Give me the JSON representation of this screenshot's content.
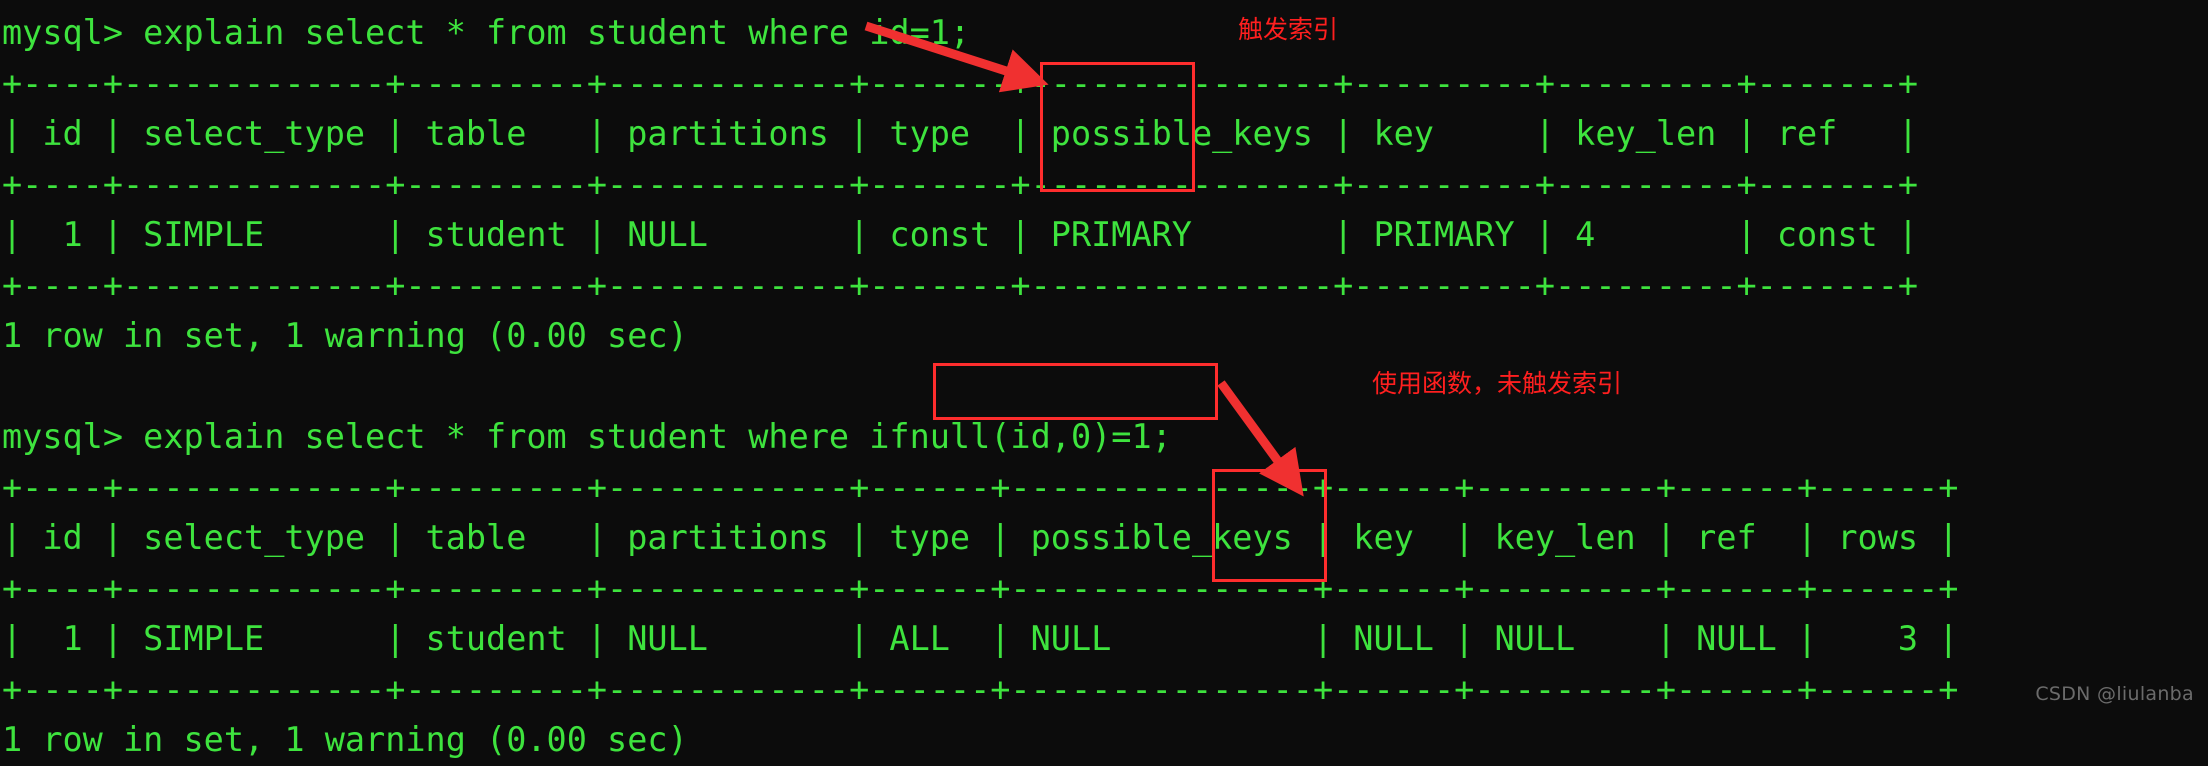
{
  "terminal": {
    "background_color": "#0c0c0c",
    "text_color": "#3ee33e",
    "annotation_color": "#ff2d2d",
    "lines": [
      "mysql> explain select * from student where id=1;",
      "+----+-------------+---------+------------+-------+---------------+---------+---------+-------+",
      "| id | select_type | table   | partitions | type  | possible_keys | key     | key_len | ref   |",
      "+----+-------------+---------+------------+-------+---------------+---------+---------+-------+",
      "|  1 | SIMPLE      | student | NULL       | const | PRIMARY       | PRIMARY | 4       | const |",
      "+----+-------------+---------+------------+-------+---------------+---------+---------+-------+",
      "1 row in set, 1 warning (0.00 sec)",
      "",
      "mysql> explain select * from student where ifnull(id,0)=1;",
      "+----+-------------+---------+------------+------+---------------+------+---------+------+------+",
      "| id | select_type | table   | partitions | type | possible_keys | key  | key_len | ref  | rows |",
      "+----+-------------+---------+------------+------+---------------+------+---------+------+------+",
      "|  1 | SIMPLE      | student | NULL       | ALL  | NULL          | NULL | NULL    | NULL |    3 |",
      "+----+-------------+---------+------------+------+---------------+------+---------+------+------+",
      "1 row in set, 1 warning (0.00 sec)"
    ]
  },
  "queries": [
    {
      "prompt": "mysql>",
      "sql": "explain select * from student where id=1;",
      "result_status": "1 row in set, 1 warning (0.00 sec)",
      "columns": [
        "id",
        "select_type",
        "table",
        "partitions",
        "type",
        "possible_keys",
        "key",
        "key_len",
        "ref"
      ],
      "rows": [
        [
          "1",
          "SIMPLE",
          "student",
          "NULL",
          "const",
          "PRIMARY",
          "PRIMARY",
          "4",
          "const"
        ]
      ]
    },
    {
      "prompt": "mysql>",
      "sql": "explain select * from student where ifnull(id,0)=1;",
      "result_status": "1 row in set, 1 warning (0.00 sec)",
      "columns": [
        "id",
        "select_type",
        "table",
        "partitions",
        "type",
        "possible_keys",
        "key",
        "key_len",
        "ref",
        "rows"
      ],
      "rows": [
        [
          "1",
          "SIMPLE",
          "student",
          "NULL",
          "ALL",
          "NULL",
          "NULL",
          "NULL",
          "NULL",
          "3"
        ]
      ]
    }
  ],
  "annotations": [
    {
      "id": "trigger-index",
      "label": "触发索引",
      "target": "key column of first explain result (PRIMARY)"
    },
    {
      "id": "no-index",
      "label": "使用函数，未触发索引",
      "target": "key column of second explain result (NULL)"
    }
  ],
  "watermark": "CSDN @liulanba"
}
